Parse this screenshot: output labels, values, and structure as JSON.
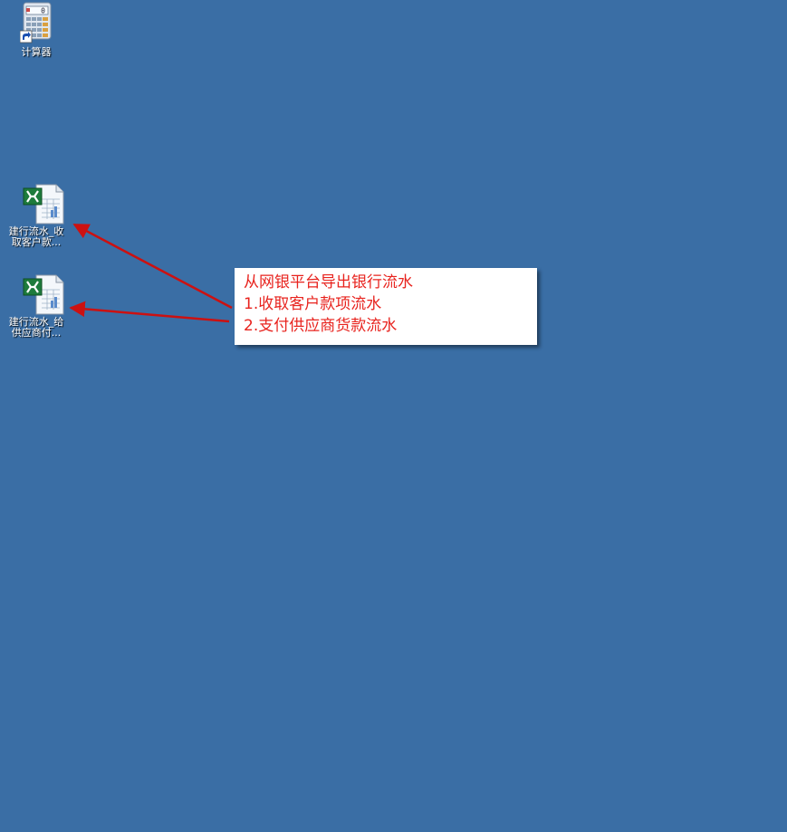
{
  "desktop": {
    "background_color": "#3a6ea5",
    "icons": [
      {
        "label": "计算器",
        "icon": "calculator-icon",
        "shortcut": true
      },
      {
        "label_line1": "建行流水_收",
        "label_line2": "取客户款...",
        "icon": "excel-file-icon"
      },
      {
        "label_line1": "建行流水_给",
        "label_line2": "供应商付...",
        "icon": "excel-file-icon"
      }
    ]
  },
  "callout": {
    "line1": "从网银平台导出银行流水",
    "line2": "1.收取客户款项流水",
    "line3": "2.支付供应商货款流水",
    "text_color": "#e8231e",
    "arrow_color": "#cc1111"
  }
}
